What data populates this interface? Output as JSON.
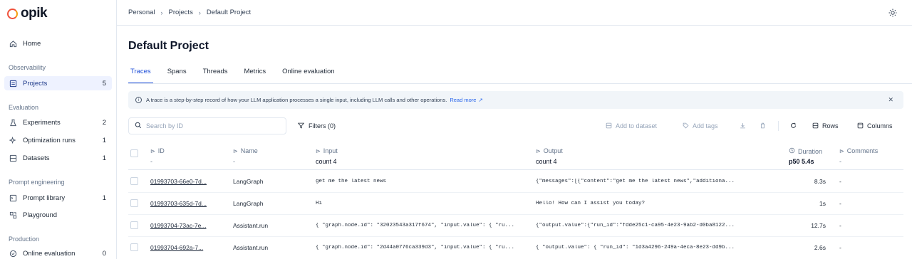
{
  "app": {
    "logo_text": "opik"
  },
  "breadcrumb": [
    "Personal",
    "Projects",
    "Default Project"
  ],
  "sidebar": {
    "home": "Home",
    "sections": {
      "observability": "Observability",
      "evaluation": "Evaluation",
      "prompt_engineering": "Prompt engineering",
      "production": "Production"
    },
    "projects": {
      "label": "Projects",
      "count": "5"
    },
    "experiments": {
      "label": "Experiments",
      "count": "2"
    },
    "optimization_runs": {
      "label": "Optimization runs",
      "count": "1"
    },
    "datasets": {
      "label": "Datasets",
      "count": "1"
    },
    "prompt_library": {
      "label": "Prompt library",
      "count": "1"
    },
    "playground": {
      "label": "Playground"
    },
    "online_evaluation": {
      "label": "Online evaluation",
      "count": "0"
    }
  },
  "page": {
    "title": "Default Project"
  },
  "tabs": [
    "Traces",
    "Spans",
    "Threads",
    "Metrics",
    "Online evaluation"
  ],
  "banner": {
    "text": "A trace is a step-by-step record of how your LLM application processes a single input, including LLM calls and other operations.",
    "link": "Read more"
  },
  "toolbar": {
    "search_placeholder": "Search by ID",
    "filters": "Filters (0)",
    "add_to_dataset": "Add to dataset",
    "add_tags": "Add tags",
    "rows": "Rows",
    "columns": "Columns"
  },
  "table": {
    "columns": {
      "id": "ID",
      "name": "Name",
      "input": "Input",
      "output": "Output",
      "duration": "Duration",
      "comments": "Comments"
    },
    "subheaders": {
      "id": "-",
      "name": "-",
      "input": "count 4",
      "output": "count 4",
      "duration": "p50 5.4s",
      "comments": "-"
    },
    "rows": [
      {
        "id": "01993703-66e0-7d...",
        "name": "LangGraph",
        "input": "get me the latest news",
        "output": "{\"messages\":[{\"content\":\"get me the latest news\",\"additiona...",
        "duration": "8.3s",
        "comments": "-"
      },
      {
        "id": "01993703-635d-7d...",
        "name": "LangGraph",
        "input": "Hi",
        "output": "Hello! How can I assist you today?",
        "duration": "1s",
        "comments": "-"
      },
      {
        "id": "01993704-73ac-7e...",
        "name": "Assistant.run",
        "input": "{ \"graph.node.id\": \"32023543a317f674\", \"input.value\": { \"ru...",
        "output": "{\"output.value\":{\"run_id\":\"fdde25c1-ca95-4e23-9ab2-d0ba8122...",
        "duration": "12.7s",
        "comments": "-"
      },
      {
        "id": "01993704-692a-7...",
        "name": "Assistant.run",
        "input": "{ \"graph.node.id\": \"2d44a0776ca339d3\", \"input.value\": { \"ru...",
        "output": "{ \"output.value\": { \"run_id\": \"1d3a4296-249a-4eca-8e23-dd9b...",
        "duration": "2.6s",
        "comments": "-"
      }
    ]
  }
}
